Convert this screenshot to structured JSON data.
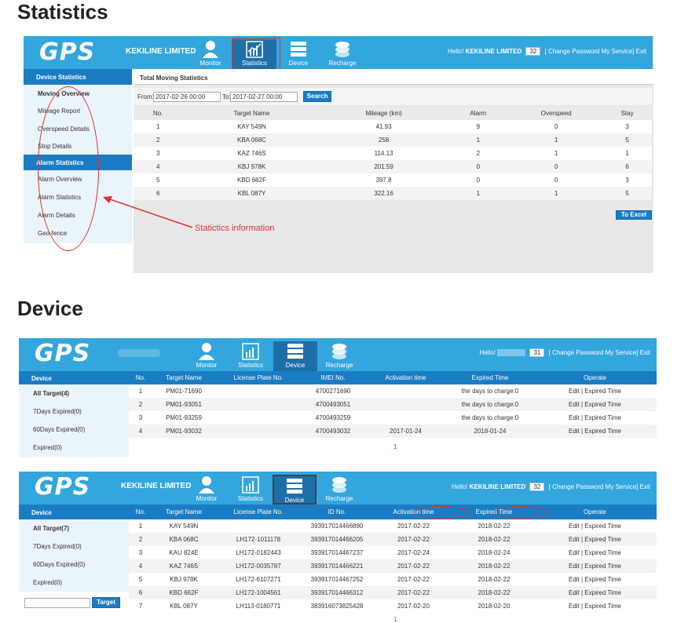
{
  "headings": {
    "statistics": "Statistics",
    "device": "Device"
  },
  "brand": {
    "logo": "GPS",
    "company": "KEKILINE LIMITED"
  },
  "nav": [
    {
      "label": "Monitor",
      "icon": "person-icon"
    },
    {
      "label": "Statistics",
      "icon": "chart-icon"
    },
    {
      "label": "Device",
      "icon": "server-icon"
    },
    {
      "label": "Recharge",
      "icon": "coins-icon"
    }
  ],
  "header": {
    "hello": "Hello!",
    "count": "32",
    "count2": "31",
    "links": "[ Change Password  My Service] Exit"
  },
  "stats": {
    "side_head1": "Device Statistics",
    "side_items1": [
      "Moving Overview",
      "Mileage Report",
      "Overspeed Details",
      "Stop Details"
    ],
    "side_head2": "Alarm Statistics",
    "side_items2": [
      "Alarm Overview",
      "Alarm Statistics",
      "Alarm Details",
      "Geo-fence"
    ],
    "title": "Total Moving Statistics",
    "from_label": "From:",
    "from_value": "2017-02-26 00:00",
    "to_label": "To:",
    "to_value": "2017-02-27 00:00",
    "search": "Search",
    "columns": [
      "No.",
      "Target Name",
      "Mileage (km)",
      "Alarm",
      "Overspeed",
      "Stay"
    ],
    "rows": [
      [
        "1",
        "KAY 549N",
        "41.93",
        "9",
        "0",
        "3"
      ],
      [
        "2",
        "KBA 068C",
        "258",
        "1",
        "1",
        "5"
      ],
      [
        "3",
        "KAZ 746S",
        "114.13",
        "2",
        "1",
        "1"
      ],
      [
        "4",
        "KBJ 978K",
        "201.59",
        "0",
        "0",
        "6"
      ],
      [
        "5",
        "KBD 662F",
        "397.8",
        "0",
        "0",
        "3"
      ],
      [
        "6",
        "KBL 087Y",
        "322.16",
        "1",
        "1",
        "5"
      ]
    ],
    "excel": "To Excel",
    "annotation": "Statictics information"
  },
  "device1": {
    "side_head": "Device",
    "side_items": [
      "All Target(4)",
      "7Days Expired(0)",
      "60Days Expired(0)",
      "Expired(0)"
    ],
    "columns": [
      "No.",
      "Target Name",
      "License Plate No.",
      "IMEI No.",
      "Activation time",
      "Expired Time",
      "Operate"
    ],
    "rows": [
      [
        "1",
        "PM01-71690",
        "",
        "4700271690",
        "",
        "the days to charge:0",
        "Edit | Expired Time"
      ],
      [
        "2",
        "PM01-93051",
        "",
        "4700493051",
        "",
        "the days to charge:0",
        "Edit | Expired Time"
      ],
      [
        "3",
        "PM01-93259",
        "",
        "4700493259",
        "",
        "the days to charge:0",
        "Edit | Expired Time"
      ],
      [
        "4",
        "PM01-93032",
        "",
        "4700493032",
        "2017-01-24",
        "2018-01-24",
        "Edit | Expired Time"
      ]
    ],
    "page": "1"
  },
  "device2": {
    "side_head": "Device",
    "side_items": [
      "All Target(7)",
      "7Days Expired(0)",
      "60Days Expired(0)",
      "Expired(0)"
    ],
    "target_btn": "Target",
    "columns": [
      "No.",
      "Target Name",
      "License Plate No.",
      "ID No.",
      "Activation time",
      "Expired Time",
      "Operate"
    ],
    "rows": [
      [
        "1",
        "KAY 549N",
        "",
        "393917014466890",
        "2017-02-22",
        "2018-02-22",
        "Edit | Expired Time"
      ],
      [
        "2",
        "KBA 068C",
        "LH172-1011178",
        "393917014466205",
        "2017-02-22",
        "2018-02-22",
        "Edit | Expired Time"
      ],
      [
        "3",
        "KAU 824E",
        "LH172-0182443",
        "393917014467237",
        "2017-02-24",
        "2018-02-24",
        "Edit | Expired Time"
      ],
      [
        "4",
        "KAZ 746S",
        "LH172-0035787",
        "393917014466221",
        "2017-02-22",
        "2018-02-22",
        "Edit | Expired Time"
      ],
      [
        "5",
        "KBJ 978K",
        "LH172-6107271",
        "393917014467252",
        "2017-02-22",
        "2018-02-22",
        "Edit | Expired Time"
      ],
      [
        "6",
        "KBD 662F",
        "LH172-1004561",
        "393917014466312",
        "2017-02-22",
        "2018-02-22",
        "Edit | Expired Time"
      ],
      [
        "7",
        "KBL 087Y",
        "LH113-0180771",
        "383916073825428",
        "2017-02-20",
        "2018-02-20",
        "Edit | Expired Time"
      ]
    ],
    "page": "1"
  },
  "colors": {
    "header": "#33a6dd",
    "active": "#1e6fa8",
    "bar": "#1a7dc4",
    "annotation": "#e03030"
  }
}
